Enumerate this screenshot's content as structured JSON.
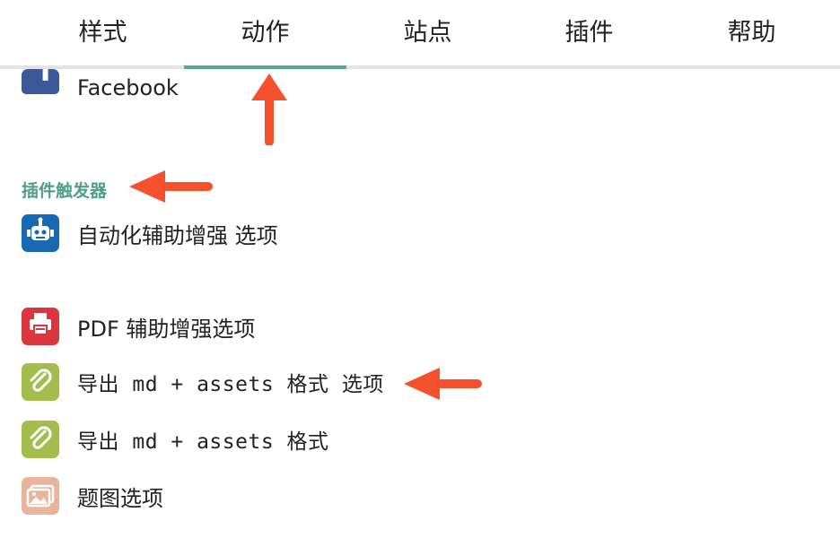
{
  "tabs": [
    {
      "label": "样式",
      "active": false
    },
    {
      "label": "动作",
      "active": true
    },
    {
      "label": "站点",
      "active": false
    },
    {
      "label": "插件",
      "active": false
    },
    {
      "label": "帮助",
      "active": false
    }
  ],
  "colors": {
    "accent": "#5aa593",
    "section_title": "#4e9e8a",
    "annotation_arrow": "#f4512c",
    "facebook": "#3b5998",
    "robot": "#1868b2",
    "pdf": "#d9363e",
    "clip": "#a3be4c",
    "image": "#eab39b"
  },
  "items_top": [
    {
      "label": "Facebook",
      "icon": "facebook-icon"
    }
  ],
  "section": {
    "title": "插件触发器",
    "items": [
      {
        "label": "自动化辅助增强 选项",
        "icon": "robot-icon"
      },
      {
        "label": "PDF 辅助增强选项",
        "icon": "pdf-printer-icon"
      },
      {
        "label": "导出 md + assets 格式 选项",
        "icon": "paperclip-icon"
      },
      {
        "label": "导出 md + assets 格式",
        "icon": "paperclip-icon"
      },
      {
        "label": "题图选项",
        "icon": "image-icon"
      }
    ]
  }
}
